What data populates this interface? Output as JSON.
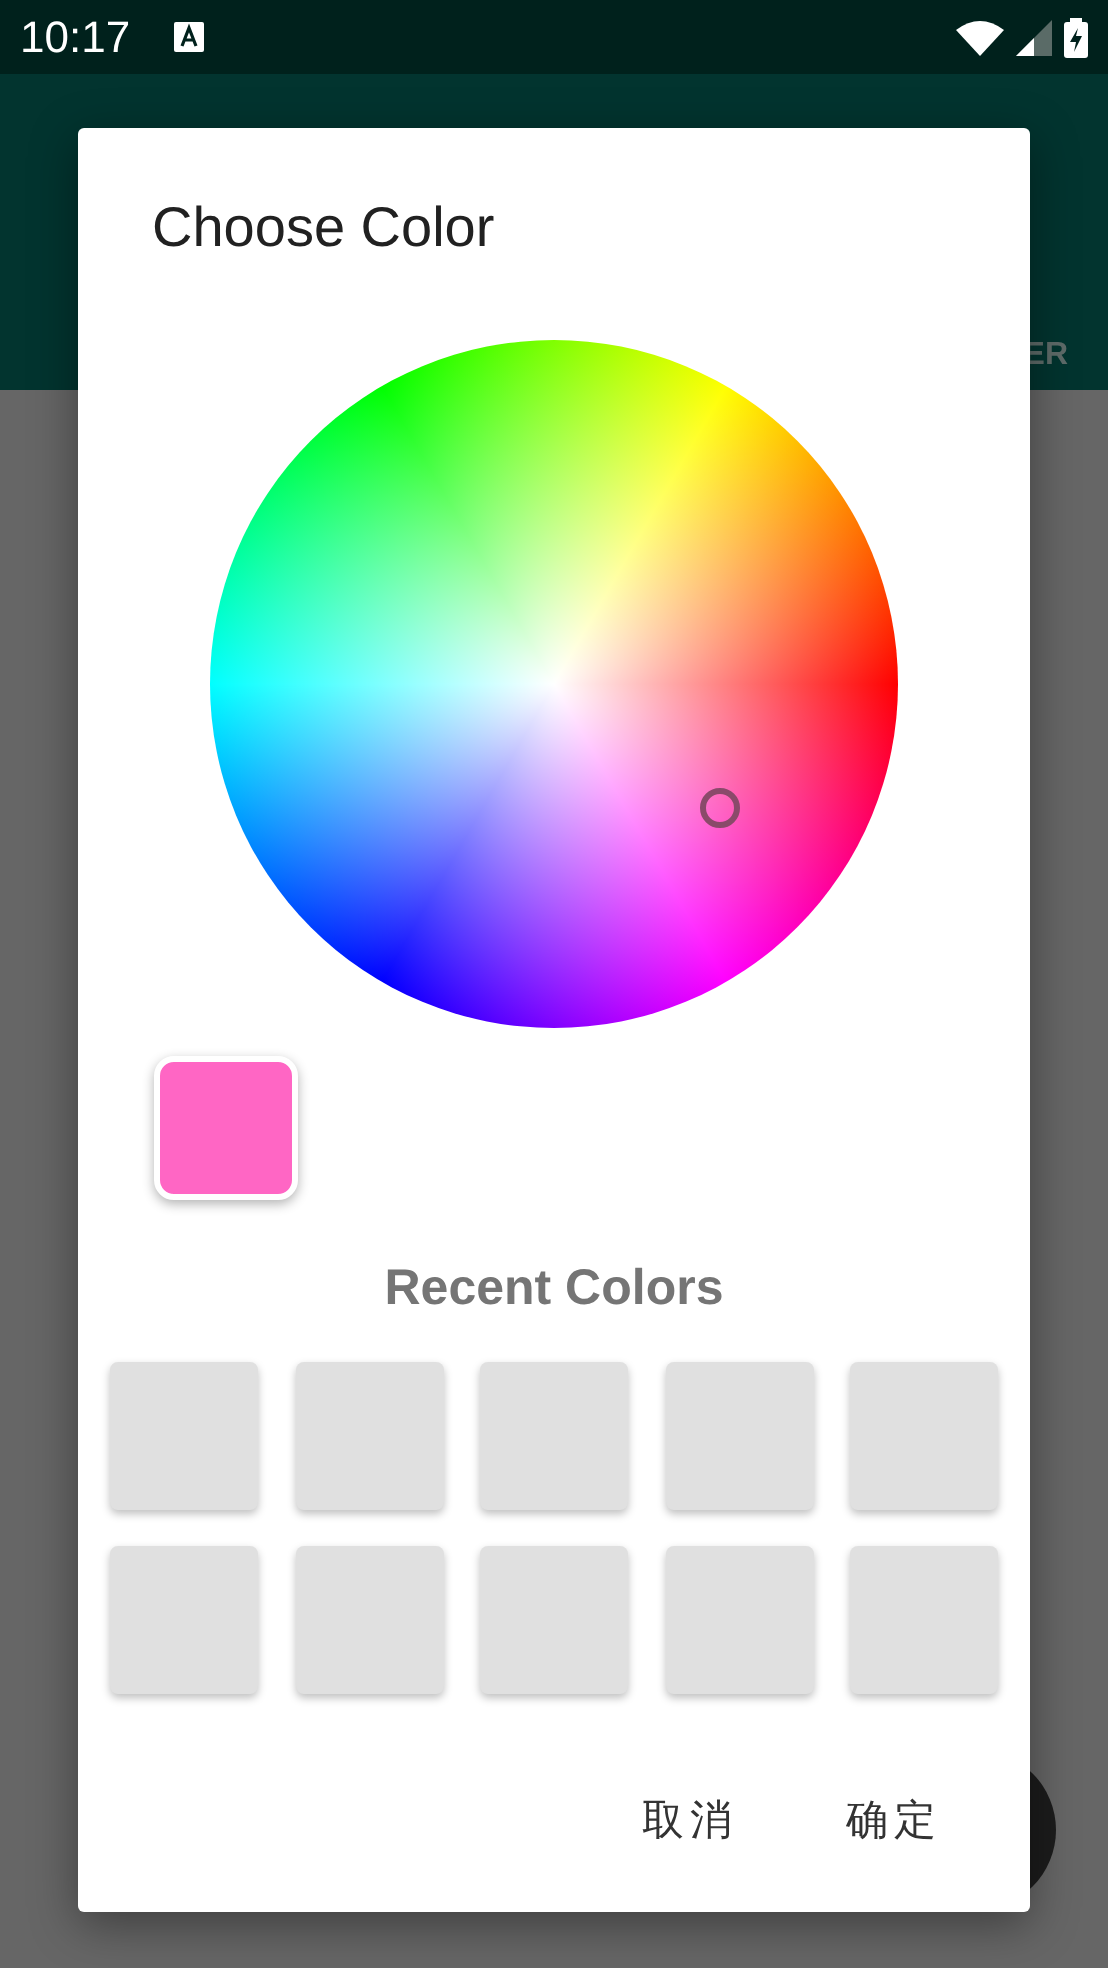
{
  "status_bar": {
    "time": "10:17"
  },
  "app_bar": {
    "action": "ER"
  },
  "dialog": {
    "title": "Choose Color",
    "swatch": {
      "color": "#ff66c4"
    },
    "recent_colors": {
      "title": "Recent Colors",
      "slots": [
        {
          "kind": "empty"
        },
        {
          "kind": "empty"
        },
        {
          "kind": "empty"
        },
        {
          "kind": "empty"
        },
        {
          "kind": "empty"
        },
        {
          "kind": "empty"
        },
        {
          "kind": "empty"
        },
        {
          "kind": "empty"
        },
        {
          "kind": "empty"
        },
        {
          "kind": "empty"
        }
      ]
    },
    "buttons": [
      "取消",
      "确定"
    ]
  }
}
